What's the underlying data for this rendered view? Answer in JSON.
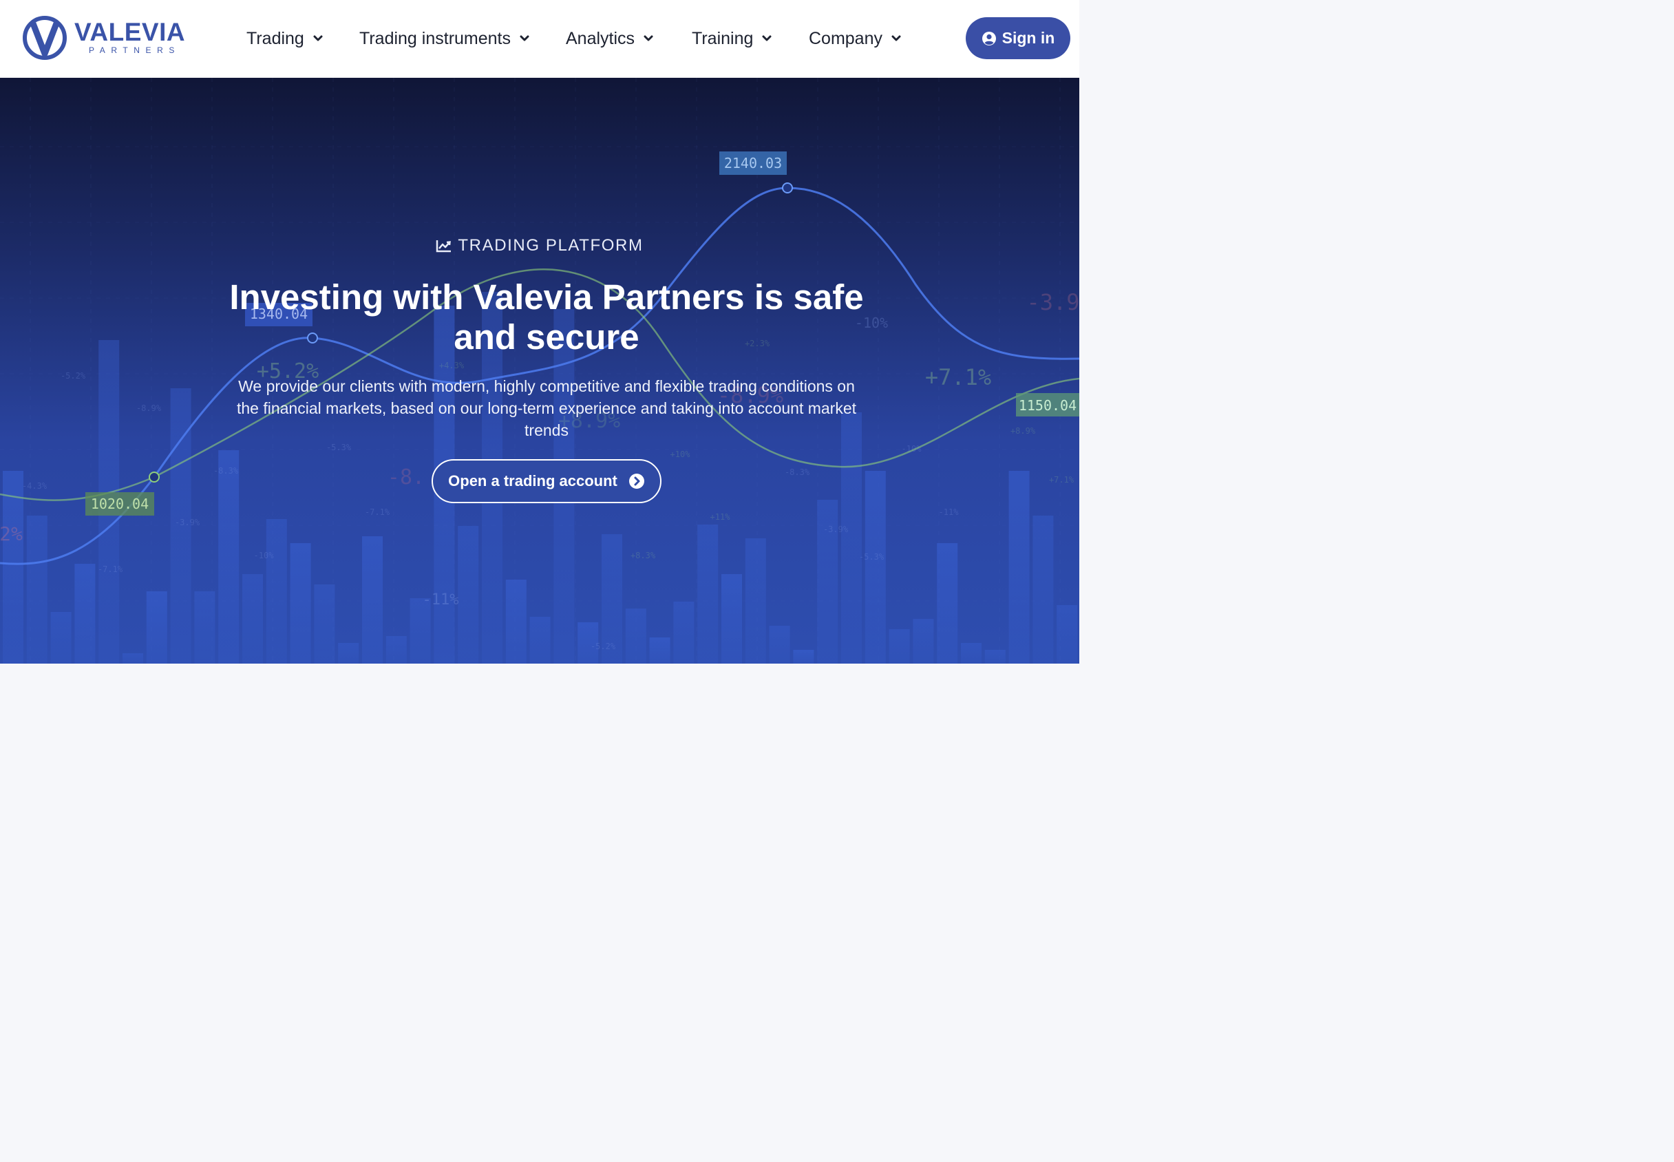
{
  "header": {
    "logo": {
      "name": "VALEVIA",
      "sub": "PARTNERS"
    },
    "nav": [
      {
        "label": "Trading"
      },
      {
        "label": "Trading instruments"
      },
      {
        "label": "Analytics"
      },
      {
        "label": "Training"
      },
      {
        "label": "Company"
      }
    ],
    "signin_label": "Sign in"
  },
  "hero": {
    "eyebrow": "TRADING PLATFORM",
    "title": "Investing with Valevia Partners is safe and secure",
    "description": "We provide our clients with modern, highly competitive and flexible trading conditions on the financial markets, based on our long-term experience and taking into account market trends",
    "cta_label": "Open a trading account",
    "background": {
      "price_tags": [
        "2140.03",
        "1340.04",
        "1020.04",
        "1150.04"
      ],
      "percent_labels": [
        "+5.2%",
        "+7.1%",
        "-10%",
        "-3.9",
        "-8.9%",
        "+8.9%",
        "-11%",
        "2%",
        "-8.",
        "-5.2%",
        "-8.9%",
        "-4.3%",
        "-7.1%",
        "-3.9%",
        "-10%",
        "-5.3%",
        "+4.3%",
        "+2.3%",
        "-7.1%",
        "-8.3%",
        "+10%",
        "+11%",
        "-3.9%",
        "-5.3%",
        "-10%",
        "+8.3%",
        "-5.2%",
        "+8.9%",
        "+7.1%",
        "-11%",
        "-8.3%"
      ]
    }
  },
  "colors": {
    "brand": "#3a53a8",
    "hero_top": "#101637",
    "hero_bottom": "#2e4eb0",
    "page_bg": "#f6f7fa"
  },
  "icons": {
    "signin": "user-circle-icon",
    "eyebrow": "chart-line-icon",
    "cta": "arrow-circle-right-icon",
    "nav": "chevron-down-icon"
  }
}
